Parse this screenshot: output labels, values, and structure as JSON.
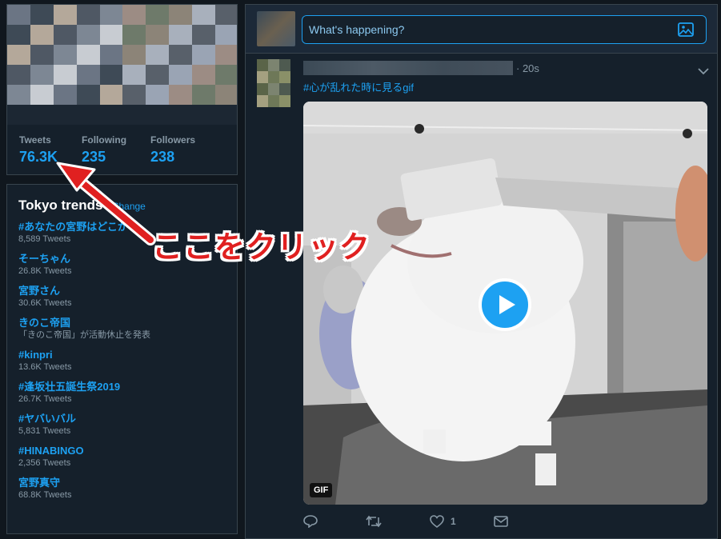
{
  "profile": {
    "stats": [
      {
        "label": "Tweets",
        "value": "76.3K"
      },
      {
        "label": "Following",
        "value": "235"
      },
      {
        "label": "Followers",
        "value": "238"
      }
    ]
  },
  "trends": {
    "title": "Tokyo trends",
    "change_label": "· Change",
    "items": [
      {
        "name": "#あなたの宮野はどこから",
        "meta": "8,589 Tweets"
      },
      {
        "name": "そーちゃん",
        "meta": "26.8K Tweets"
      },
      {
        "name": "宮野さん",
        "meta": "30.6K Tweets"
      },
      {
        "name": "きのこ帝国",
        "meta": "「きのこ帝国」が活動休止を発表"
      },
      {
        "name": "#kinpri",
        "meta": "13.6K Tweets"
      },
      {
        "name": "#逢坂壮五誕生祭2019",
        "meta": "26.7K Tweets"
      },
      {
        "name": "#ヤバいバル",
        "meta": "5,831 Tweets"
      },
      {
        "name": "#HINABINGO",
        "meta": "2,356 Tweets"
      },
      {
        "name": "宮野真守",
        "meta": "68.8K Tweets"
      }
    ]
  },
  "compose": {
    "placeholder": "What's happening?"
  },
  "tweet": {
    "timestamp": "· 20s",
    "text": "#心が乱れた時に見るgif",
    "media_badge": "GIF",
    "like_count": "1"
  },
  "annotation": {
    "text": "ここをクリック",
    "color": "#e02020"
  },
  "colors": {
    "accent": "#1da1f2",
    "background": "#10171e",
    "card": "#15202b",
    "muted": "#8899a6"
  }
}
